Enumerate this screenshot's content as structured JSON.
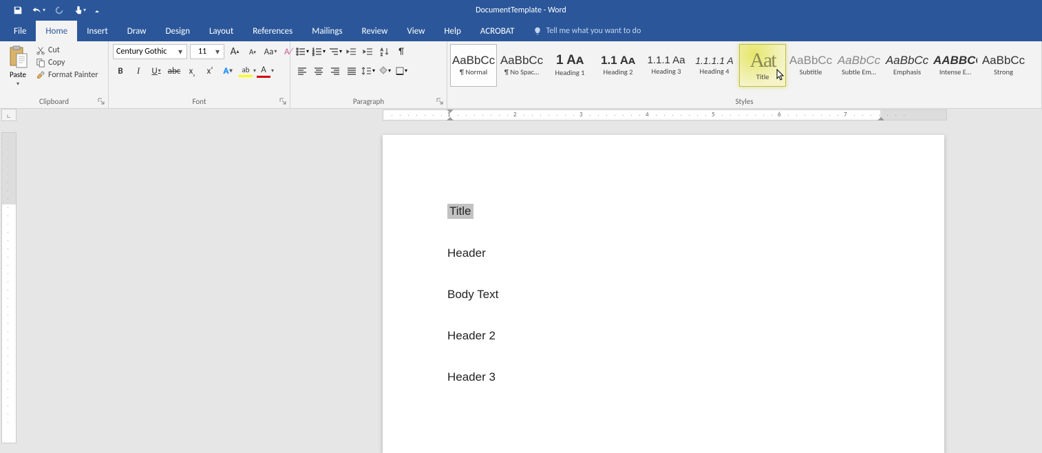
{
  "titlebar": {
    "doc_title": "DocumentTemplate - Word"
  },
  "tabs": {
    "file": "File",
    "home": "Home",
    "insert": "Insert",
    "draw": "Draw",
    "design": "Design",
    "layout": "Layout",
    "references": "References",
    "mailings": "Mailings",
    "review": "Review",
    "view": "View",
    "help": "Help",
    "acrobat": "ACROBAT",
    "tellme": "Tell me what you want to do"
  },
  "clipboard": {
    "paste": "Paste",
    "cut": "Cut",
    "copy": "Copy",
    "formatpainter": "Format Painter",
    "group_label": "Clipboard"
  },
  "font": {
    "name": "Century Gothic",
    "size": "11",
    "group_label": "Font"
  },
  "paragraph": {
    "group_label": "Paragraph"
  },
  "styles": {
    "group_label": "Styles",
    "items": [
      {
        "preview": "AaBbCc",
        "name": "¶ Normal",
        "classes": ""
      },
      {
        "preview": "AaBbCc",
        "name": "¶ No Spac…",
        "classes": ""
      },
      {
        "preview": "1  Aᴀ",
        "name": "Heading 1",
        "classes": "h1"
      },
      {
        "preview": "1.1  Aᴀ",
        "name": "Heading 2",
        "classes": "h2"
      },
      {
        "preview": "1.1.1  Aa",
        "name": "Heading 3",
        "classes": "h3"
      },
      {
        "preview": "1.1.1.1  A",
        "name": "Heading 4",
        "classes": "h4 italicprev"
      },
      {
        "preview": "Aat",
        "name": "Title",
        "classes": "titleprev"
      },
      {
        "preview": "AaBbCc",
        "name": "Subtitle",
        "classes": "gray"
      },
      {
        "preview": "AaBbCc",
        "name": "Subtle Em…",
        "classes": "gray italicprev"
      },
      {
        "preview": "AaBbCc",
        "name": "Emphasis",
        "classes": "italicprev"
      },
      {
        "preview": "AABBCC",
        "name": "Intense E…",
        "classes": "bolditalic"
      },
      {
        "preview": "AaBbCc",
        "name": "Strong",
        "classes": ""
      }
    ]
  },
  "ruler": {
    "numbers": [
      1,
      2,
      3,
      4,
      5,
      6,
      7
    ]
  },
  "document": {
    "lines": [
      {
        "text": "Title",
        "selected": true
      },
      {
        "text": "Header",
        "selected": false
      },
      {
        "text": "Body Text",
        "selected": false
      },
      {
        "text": "Header 2",
        "selected": false
      },
      {
        "text": "Header 3",
        "selected": false
      }
    ]
  }
}
